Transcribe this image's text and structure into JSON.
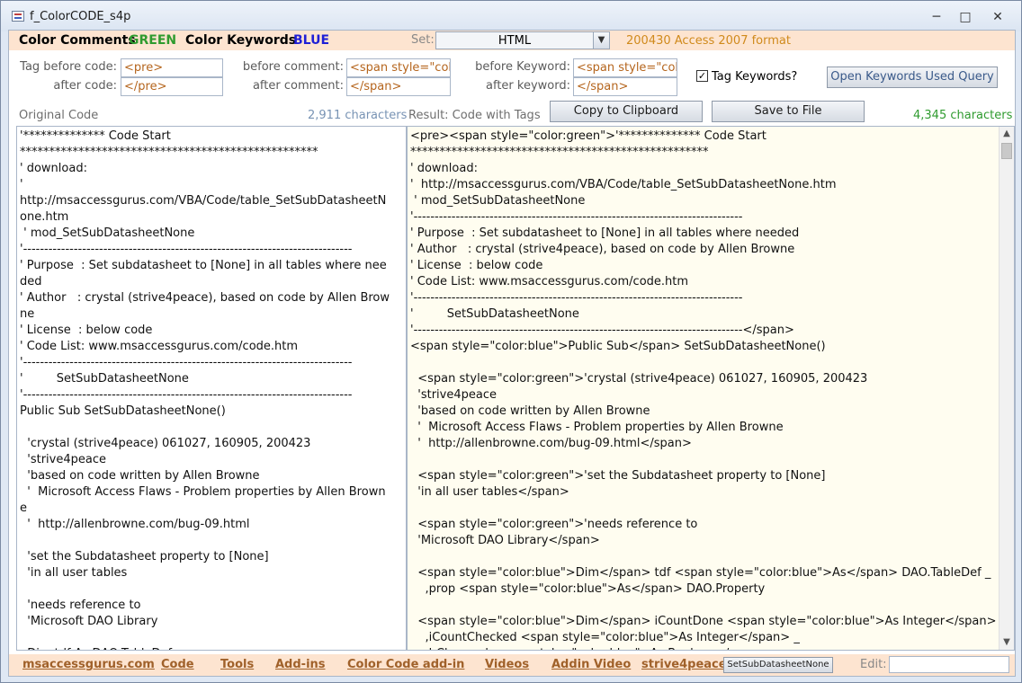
{
  "window": {
    "title": "f_ColorCODE_s4p",
    "minimize": "─",
    "maximize": "□",
    "close": "✕"
  },
  "header": {
    "color_comments_label": "Color Comments",
    "color_comments_value": "GREEN",
    "color_keywords_label": "Color Keywords",
    "color_keywords_value": "BLUE",
    "set_label": "Set:",
    "set_value": "HTML",
    "version_note": "200430 Access 2007 format"
  },
  "tags": {
    "tag_before_code_label": "Tag before code:",
    "tag_before_code": "<pre>",
    "after_code_label": "after code:",
    "after_code": "</pre>",
    "before_comment_label": "before comment:",
    "before_comment": "<span style=\"colo",
    "after_comment_label": "after comment:",
    "after_comment": "</span>",
    "before_keyword_label": "before Keyword:",
    "before_keyword": "<span style=\"colo",
    "after_keyword_label": "after keyword:",
    "after_keyword": "</span>",
    "tag_keywords_label": "Tag Keywords?",
    "tag_keywords_checked": "✓",
    "open_keywords_button": "Open Keywords Used Query"
  },
  "original": {
    "label": "Original Code",
    "count": "2,911  characters",
    "code": "'************** Code Start\n***************************************************\n' download:\n'\nhttp://msaccessgurus.com/VBA/Code/table_SetSubDatasheetNone.htm\n ' mod_SetSubDatasheetNone\n'------------------------------------------------------------------------------\n' Purpose  : Set subdatasheet to [None] in all tables where needed\n' Author   : crystal (strive4peace), based on code by Allen Browne\n' License  : below code\n' Code List: www.msaccessgurus.com/code.htm\n'------------------------------------------------------------------------------\n'         SetSubDatasheetNone\n'------------------------------------------------------------------------------\nPublic Sub SetSubDatasheetNone()\n\n  'crystal (strive4peace) 061027, 160905, 200423\n  'strive4peace\n  'based on code written by Allen Browne\n  '  Microsoft Access Flaws - Problem properties by Allen Browne\n  '  http://allenbrowne.com/bug-09.html\n\n  'set the Subdatasheet property to [None]\n  'in all user tables\n\n  'needs reference to\n  'Microsoft DAO Library\n\n  Dim tdf As DAO.TableDef _\n    , prop As DAO.Property\n\n  Dim iCountDone As Integer"
  },
  "result": {
    "label": "Result: Code with Tags",
    "copy_button": "Copy to Clipboard",
    "save_button": "Save to File",
    "count": "4,345  characters",
    "code": "<pre><span style=\"color:green\">'************** Code Start\n***************************************************\n' download:\n'  http://msaccessgurus.com/VBA/Code/table_SetSubDatasheetNone.htm\n ' mod_SetSubDatasheetNone\n'------------------------------------------------------------------------------\n' Purpose  : Set subdatasheet to [None] in all tables where needed\n' Author   : crystal (strive4peace), based on code by Allen Browne\n' License  : below code\n' Code List: www.msaccessgurus.com/code.htm\n'------------------------------------------------------------------------------\n'         SetSubDatasheetNone\n'------------------------------------------------------------------------------</span>\n<span style=\"color:blue\">Public Sub</span> SetSubDatasheetNone()\n\n  <span style=\"color:green\">'crystal (strive4peace) 061027, 160905, 200423\n  'strive4peace\n  'based on code written by Allen Browne\n  '  Microsoft Access Flaws - Problem properties by Allen Browne\n  '  http://allenbrowne.com/bug-09.html</span>\n\n  <span style=\"color:green\">'set the Subdatasheet property to [None]\n  'in all user tables</span>\n\n  <span style=\"color:green\">'needs reference to\n  'Microsoft DAO Library</span>\n\n  <span style=\"color:blue\">Dim</span> tdf <span style=\"color:blue\">As</span> DAO.TableDef _\n    ,prop <span style=\"color:blue\">As</span> DAO.Property\n\n  <span style=\"color:blue\">Dim</span> iCountDone <span style=\"color:blue\">As Integer</span> _\n    ,iCountChecked <span style=\"color:blue\">As Integer</span> _\n    ,bChanged <span style=\"color:blue\">As Boolean</span>"
  },
  "footer": {
    "links": [
      "msaccessgurus.com",
      "Code",
      "Tools",
      "Add-ins",
      "Color Code add-in",
      "Videos",
      "Addin Video",
      "strive4peace"
    ],
    "proc_button": "SetSubDatasheetNone",
    "edit_label": "Edit:"
  }
}
